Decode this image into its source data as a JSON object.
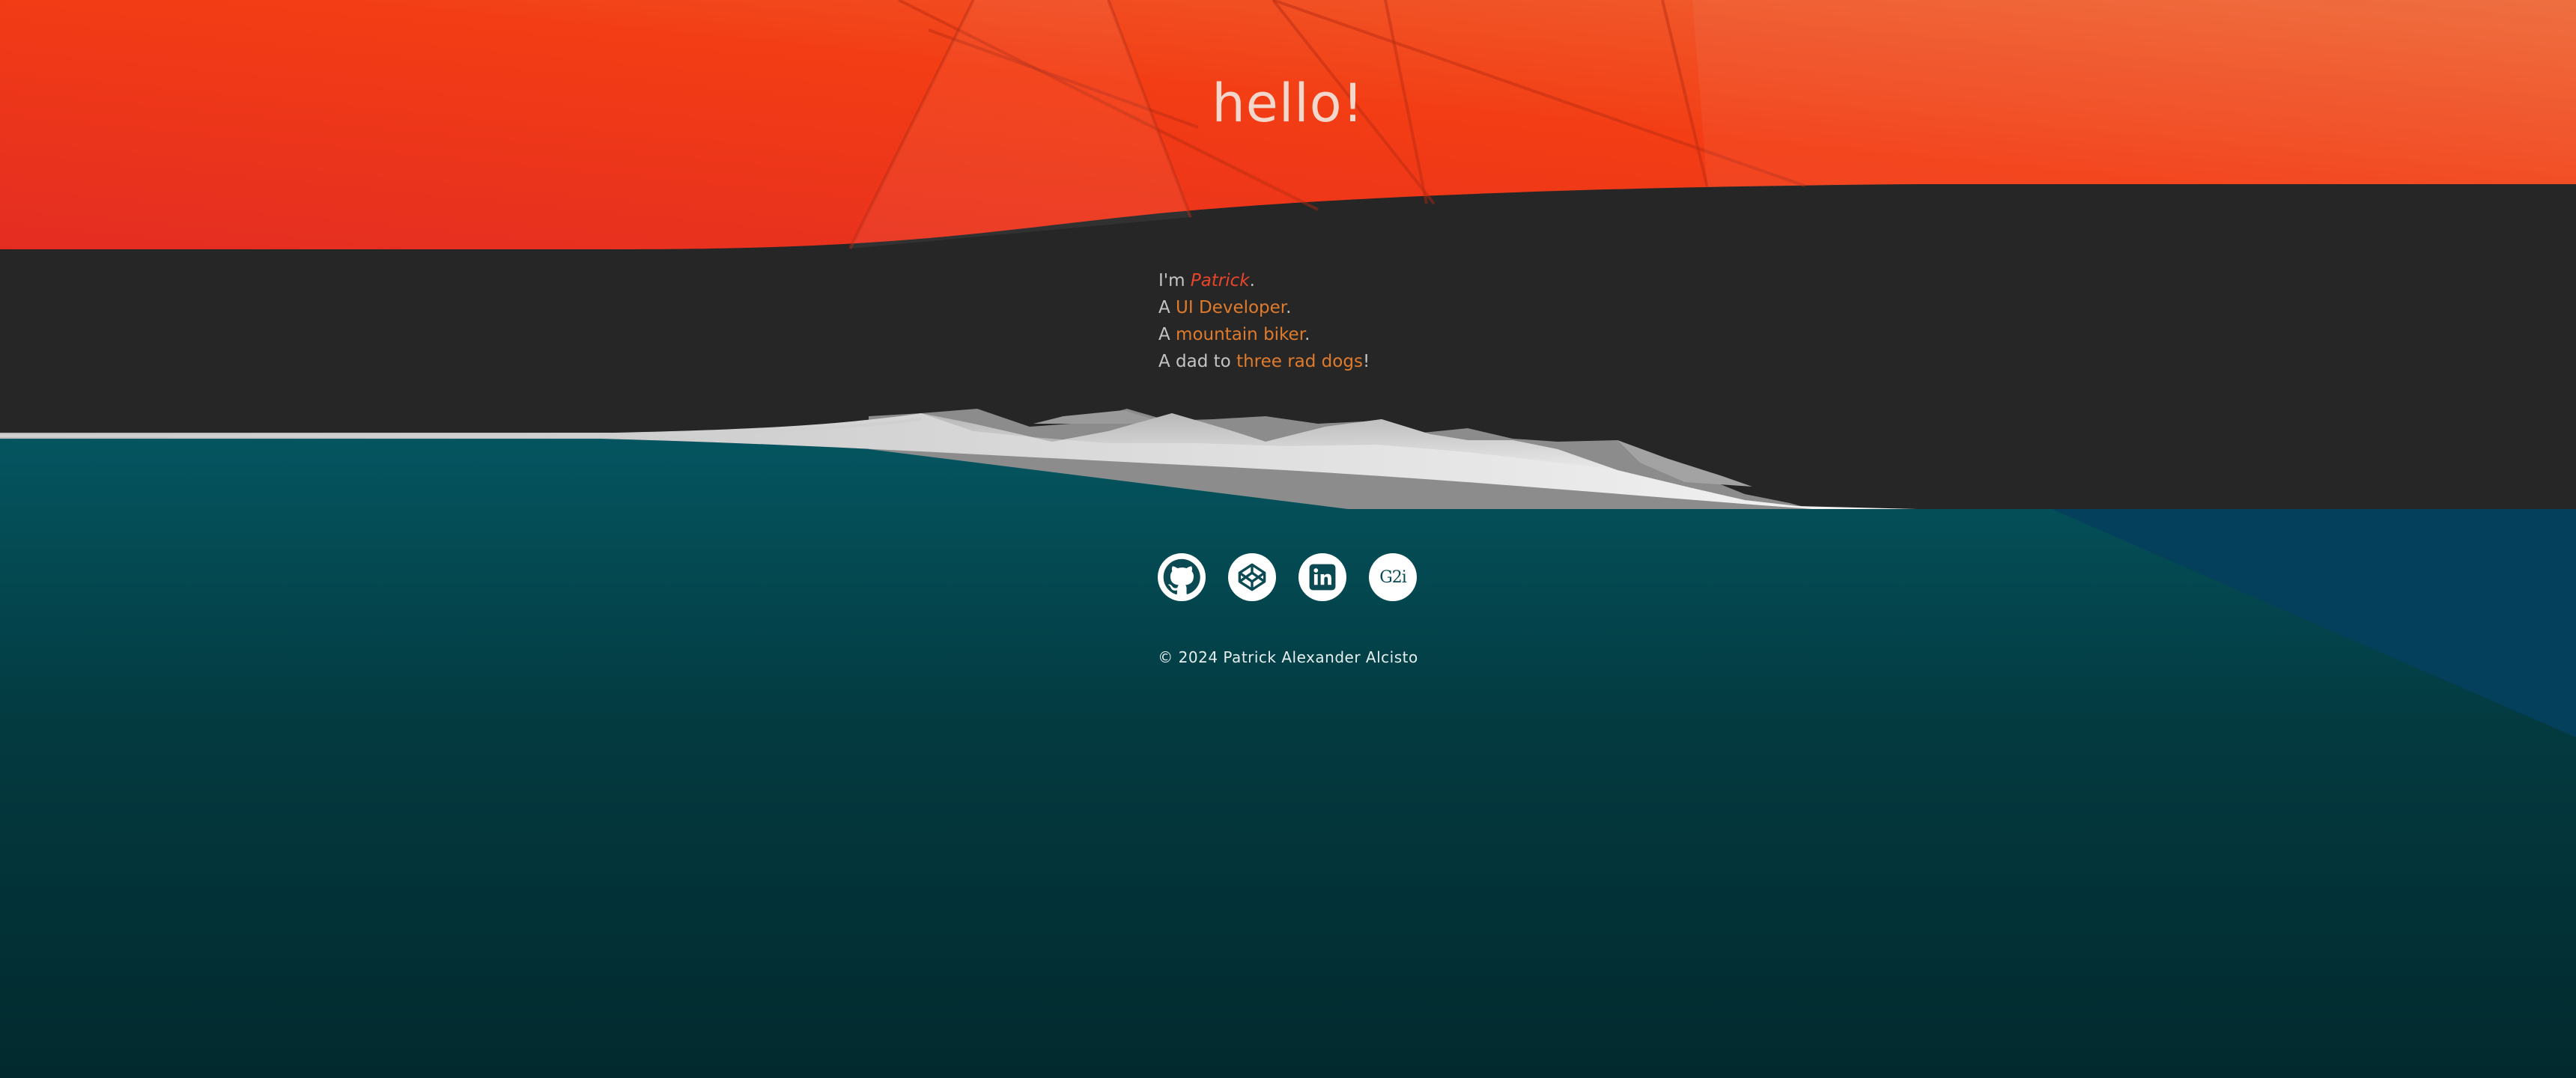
{
  "header": {
    "greeting": "hello!"
  },
  "intro": {
    "line1_prefix": "I'm ",
    "line1_name": "Patrick",
    "line1_suffix": ".",
    "line2_prefix": "A ",
    "line2_highlight": "UI Developer",
    "line2_suffix": ".",
    "line3_prefix": "A ",
    "line3_highlight": "mountain biker",
    "line3_suffix": ".",
    "line4_prefix": "A dad to ",
    "line4_highlight": "three rad dogs",
    "line4_suffix": "!"
  },
  "social": {
    "links": [
      {
        "name": "GitHub",
        "icon": "github-icon"
      },
      {
        "name": "CodePen",
        "icon": "codepen-icon"
      },
      {
        "name": "LinkedIn",
        "icon": "linkedin-icon"
      },
      {
        "name": "G2i",
        "icon": "g2i-icon",
        "text": "G2i"
      }
    ]
  },
  "footer": {
    "copyright": "© 2024 Patrick Alexander Alcisto"
  },
  "colors": {
    "header_red": "#e8352a",
    "header_orange": "#ec6233",
    "dark_band": "#262626",
    "teal_top": "#044f58",
    "teal_bottom": "#022a2e",
    "name_accent": "#e8452a",
    "link_accent": "#e07b2c"
  }
}
